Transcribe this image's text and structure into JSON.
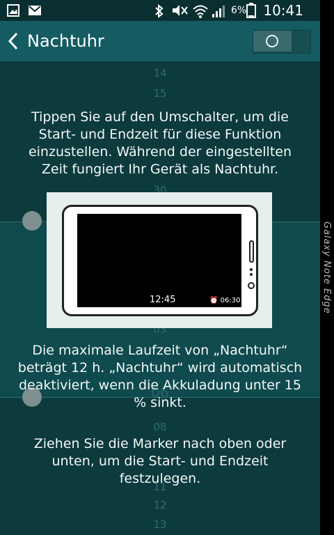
{
  "status_bar": {
    "time": "10:41",
    "battery_percent": "6%",
    "icons": [
      "picture-icon",
      "mail-icon",
      "bluetooth-icon",
      "mute-icon",
      "wifi-icon",
      "signal-icon",
      "battery-icon"
    ]
  },
  "header": {
    "title": "Nachtuhr",
    "toggle_on": false
  },
  "picker": {
    "hours_top": [
      "14",
      "15"
    ],
    "hour_mid_1": "30",
    "hour_mid_2": "03",
    "hour_mid_3": "06",
    "hours_bottom": [
      "08",
      "11",
      "12",
      "13"
    ]
  },
  "instructions": {
    "intro": "Tippen Sie auf den Umschalter, um die Start- und Endzeit für diese Funktion einzustellen. Während der eingestellten Zeit fungiert Ihr Gerät als Nachtuhr.",
    "limit": "Die maximale Laufzeit von „Nachtuhr“ beträgt 12 h. „Nachtuhr“ wird automatisch deaktiviert, wenn die Akkuladung unter 15 % sinkt.",
    "drag": "Ziehen Sie die Marker nach oben oder unten, um die Start- und Endzeit festzulegen."
  },
  "illustration": {
    "clock_time": "12:45",
    "alarm_time": "06:30"
  },
  "edge_panel": {
    "label": "Galaxy Note Edge"
  },
  "colors": {
    "background": "#0c3a3d",
    "action_bar": "#145c62",
    "status_bar": "#0a2f31"
  }
}
